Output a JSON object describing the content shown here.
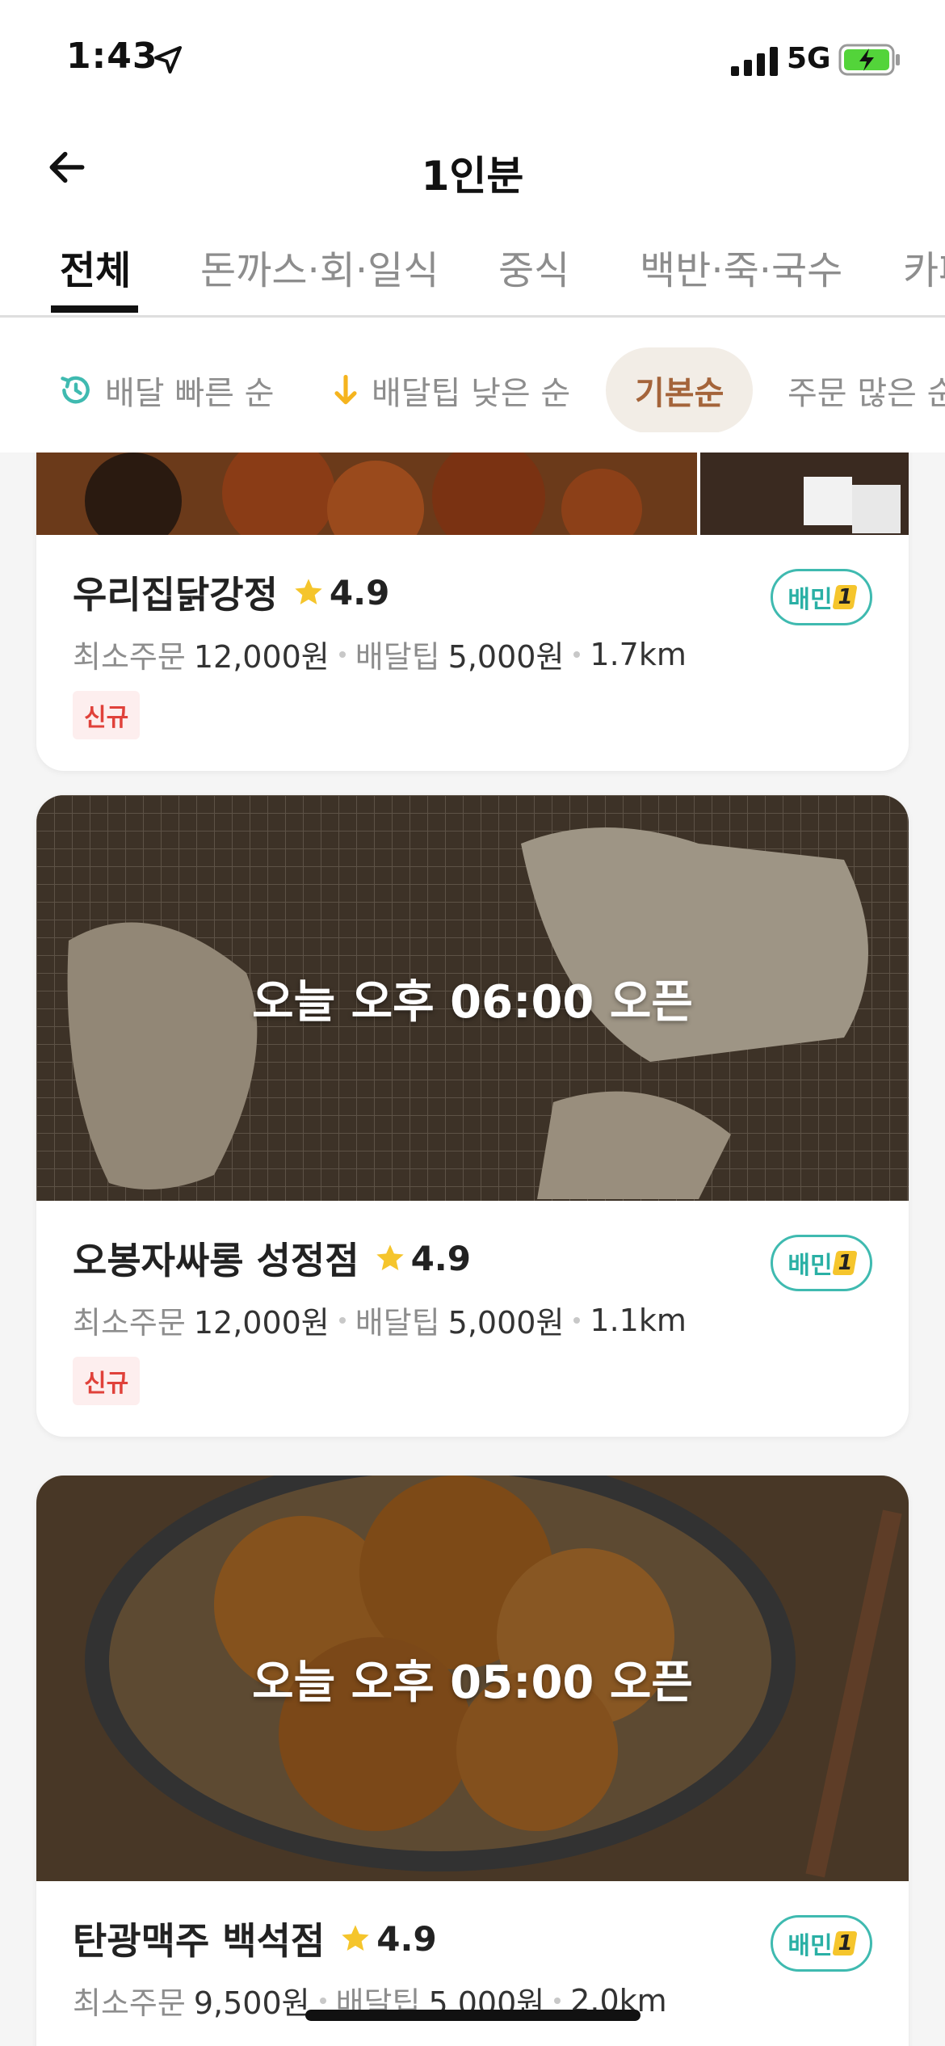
{
  "status_bar": {
    "time": "1:43",
    "network": "5G"
  },
  "header": {
    "title": "1인분",
    "back_icon": "arrow-left-icon"
  },
  "category_tabs": [
    {
      "label": "전체",
      "active": true
    },
    {
      "label": "돈까스·회·일식",
      "active": false
    },
    {
      "label": "중식",
      "active": false
    },
    {
      "label": "백반·죽·국수",
      "active": false
    },
    {
      "label": "카페",
      "active": false
    }
  ],
  "sort_options": [
    {
      "label": "배달 빠른 순",
      "icon": "clock-fast-icon"
    },
    {
      "label": "배달팁 낮은 순",
      "icon": "arrow-down-icon"
    },
    {
      "label": "기본순",
      "active": true
    },
    {
      "label": "주문 많은 순"
    }
  ],
  "colors": {
    "accent_teal": "#2ab0a5",
    "star_yellow": "#f5c52c",
    "chip_active_bg": "#f2ede6",
    "chip_active_text": "#a4643a",
    "new_badge_text": "#e0413a"
  },
  "stores": [
    {
      "name": "우리집닭강정",
      "rating": "4.9",
      "min_order_label": "최소주문",
      "min_order": "12,000원",
      "tip_label": "배달팁",
      "tip": "5,000원",
      "distance": "1.7km",
      "badge": "신규",
      "baemin": "배민",
      "baemin_one": "1"
    },
    {
      "name": "오봉자싸롱 성정점",
      "rating": "4.9",
      "open_notice": "오늘 오후 06:00 오픈",
      "min_order_label": "최소주문",
      "min_order": "12,000원",
      "tip_label": "배달팁",
      "tip": "5,000원",
      "distance": "1.1km",
      "badge": "신규",
      "baemin": "배민",
      "baemin_one": "1"
    },
    {
      "name": "탄광맥주 백석점",
      "rating": "4.9",
      "open_notice": "오늘 오후 05:00 오픈",
      "min_order_label": "최소주문",
      "min_order": "9,500원",
      "tip_label": "배달팁",
      "tip": "5,000원",
      "distance": "2.0km",
      "baemin": "배민",
      "baemin_one": "1"
    }
  ]
}
